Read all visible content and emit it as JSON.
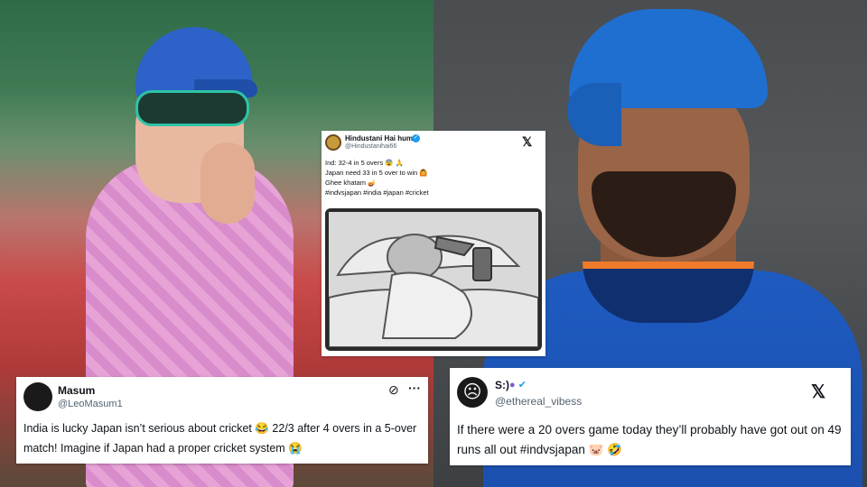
{
  "tweet_top": {
    "name": "Hindustani Hai hum",
    "handle": "@Hindustanihai66",
    "lines": [
      "Ind: 32-4 in 5 overs 😨 🙏",
      "Japan need 33 in 5 over to win 🙆",
      "Ghee khatam 🪔",
      "#indvsjapan #india #japan #cricket"
    ]
  },
  "tweet_left": {
    "name": "Masum",
    "handle": "@LeoMasum1",
    "text": "India is lucky Japan isn’t serious about cricket 😂 22/3 after 4 overs in a 5-over match! Imagine if Japan had a proper cricket system 😭"
  },
  "tweet_right": {
    "name": "S:)",
    "handle": "@ethereal_vibess",
    "text": "If there were a 20 overs game today they’ll probably have got out on 49 runs all out #indvsjapan 🐷 🤣"
  },
  "icons": {
    "x_logo": "𝕏",
    "verified": "✓"
  }
}
